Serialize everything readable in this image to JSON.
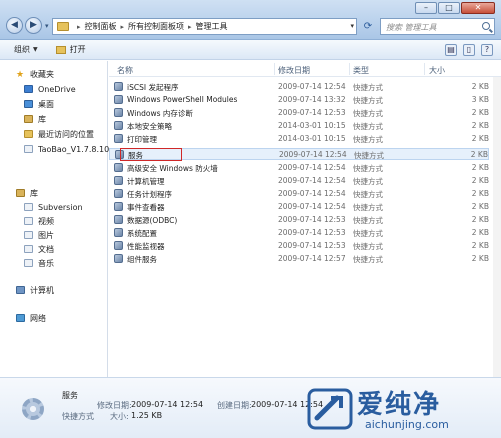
{
  "window": {
    "minimize": "–",
    "maximize": "□",
    "close": "✕"
  },
  "address": {
    "breadcrumbs": [
      "控制面板",
      "所有控制面板项",
      "管理工具"
    ],
    "separator": "▸"
  },
  "search": {
    "placeholder": "搜索 管理工具"
  },
  "toolbar": {
    "organize": "组织",
    "open": "打开"
  },
  "nav": {
    "favorites": "收藏夹",
    "onedrive": "OneDrive",
    "desktop": "桌面",
    "library_fav": "库",
    "recent": "最近访问的位置",
    "taobao": "TaoBao_V1.7.8.10_",
    "libraries": "库",
    "subversion": "Subversion",
    "videos": "视频",
    "pictures": "图片",
    "documents": "文档",
    "music": "音乐",
    "computer": "计算机",
    "network": "网络"
  },
  "columns": {
    "name": "名称",
    "date": "修改日期",
    "type": "类型",
    "size": "大小"
  },
  "files": [
    {
      "name": "iSCSI 发起程序",
      "date": "2009-07-14 12:54",
      "type": "快捷方式",
      "size": "2 KB"
    },
    {
      "name": "Windows PowerShell Modules",
      "date": "2009-07-14 13:32",
      "type": "快捷方式",
      "size": "3 KB"
    },
    {
      "name": "Windows 内存诊断",
      "date": "2009-07-14 12:53",
      "type": "快捷方式",
      "size": "2 KB"
    },
    {
      "name": "本地安全策略",
      "date": "2014-03-01 10:15",
      "type": "快捷方式",
      "size": "2 KB"
    },
    {
      "name": "打印管理",
      "date": "2014-03-01 10:15",
      "type": "快捷方式",
      "size": "2 KB"
    },
    {
      "name": "服务",
      "date": "2009-07-14 12:54",
      "type": "快捷方式",
      "size": "2 KB"
    },
    {
      "name": "高级安全 Windows 防火墙",
      "date": "2009-07-14 12:54",
      "type": "快捷方式",
      "size": "2 KB"
    },
    {
      "name": "计算机管理",
      "date": "2009-07-14 12:54",
      "type": "快捷方式",
      "size": "2 KB"
    },
    {
      "name": "任务计划程序",
      "date": "2009-07-14 12:54",
      "type": "快捷方式",
      "size": "2 KB"
    },
    {
      "name": "事件查看器",
      "date": "2009-07-14 12:54",
      "type": "快捷方式",
      "size": "2 KB"
    },
    {
      "name": "数据源(ODBC)",
      "date": "2009-07-14 12:53",
      "type": "快捷方式",
      "size": "2 KB"
    },
    {
      "name": "系统配置",
      "date": "2009-07-14 12:53",
      "type": "快捷方式",
      "size": "2 KB"
    },
    {
      "name": "性能监视器",
      "date": "2009-07-14 12:53",
      "type": "快捷方式",
      "size": "2 KB"
    },
    {
      "name": "组件服务",
      "date": "2009-07-14 12:57",
      "type": "快捷方式",
      "size": "2 KB"
    }
  ],
  "details": {
    "name": "服务",
    "modified_label": "修改日期:",
    "modified_value": "2009-07-14 12:54",
    "created_label": "创建日期:",
    "created_value": "2009-07-14 12:54",
    "type": "快捷方式",
    "size_label": "大小:",
    "size_value": "1.25 KB"
  },
  "watermark": {
    "text": "爱纯净",
    "url": "aichunjing.com"
  },
  "colors": {
    "accent": "#2a5d9f",
    "highlight": "#d02828",
    "selected": "#e6f0fb"
  }
}
